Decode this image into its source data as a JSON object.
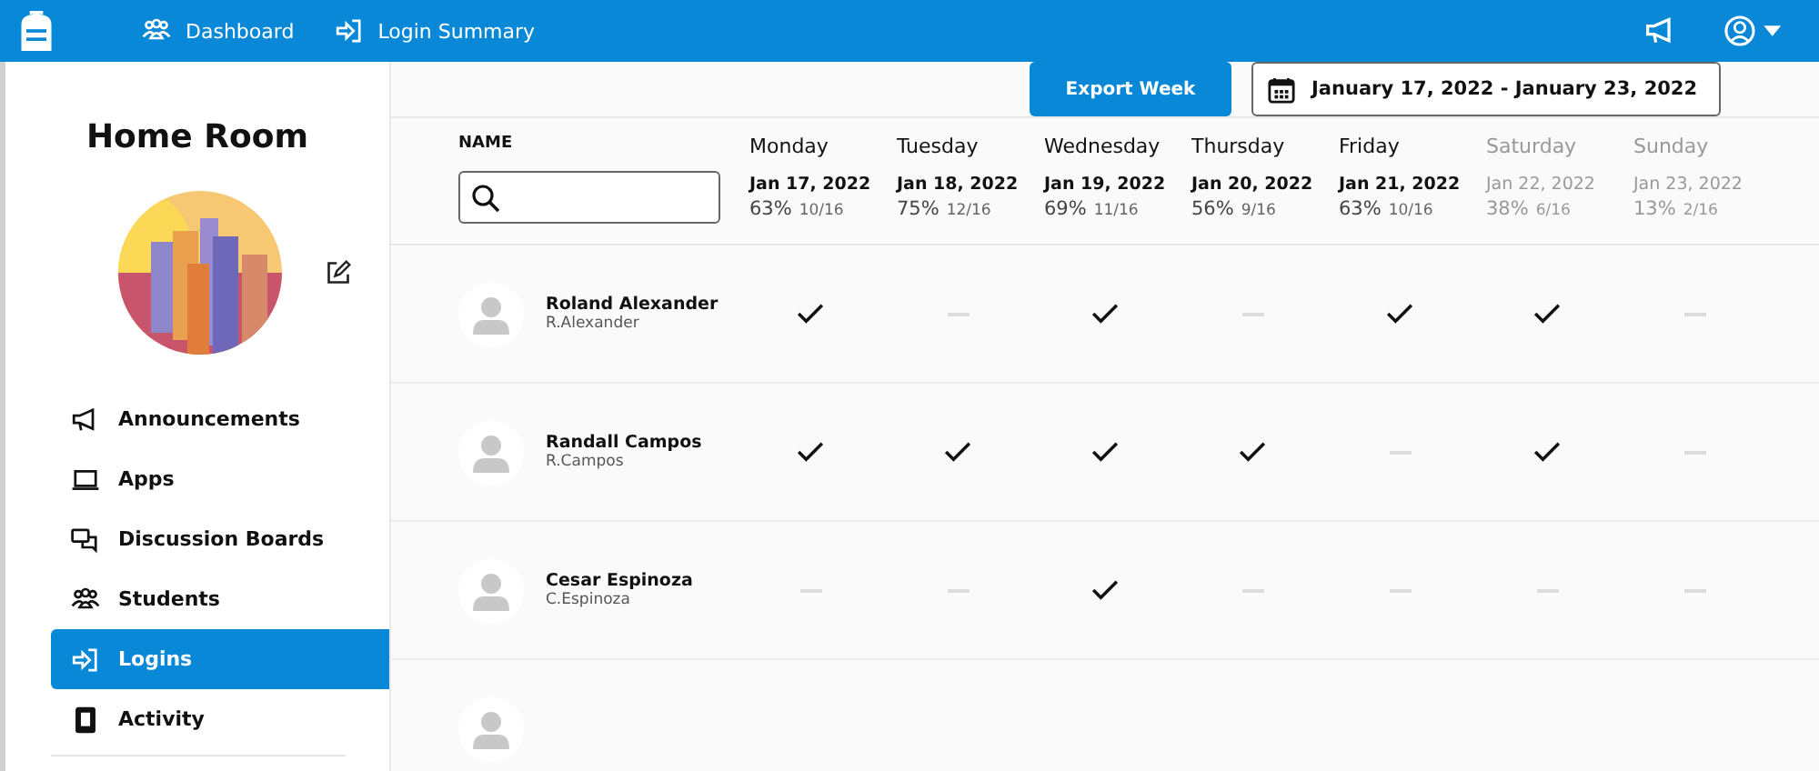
{
  "topbar": {
    "links": [
      {
        "label": "Dashboard",
        "kind": "people"
      },
      {
        "label": "Login Summary",
        "kind": "login"
      }
    ]
  },
  "sidebar": {
    "title": "Home Room",
    "items": [
      {
        "label": "Announcements",
        "kind": "megaphone",
        "selected": false
      },
      {
        "label": "Apps",
        "kind": "laptop",
        "selected": false
      },
      {
        "label": "Discussion Boards",
        "kind": "chat",
        "selected": false
      },
      {
        "label": "Students",
        "kind": "people",
        "selected": false
      },
      {
        "label": "Logins",
        "kind": "login",
        "selected": true
      },
      {
        "label": "Activity",
        "kind": "tablet",
        "selected": false
      }
    ]
  },
  "toolbar": {
    "export_button": "Export Week",
    "date_range": "January 17, 2022 - January 23, 2022"
  },
  "table": {
    "name_heading": "NAME",
    "days": [
      {
        "day": "Monday",
        "date": "Jan 17, 2022",
        "percent": "63%",
        "count": "10/16",
        "dimmed": false
      },
      {
        "day": "Tuesday",
        "date": "Jan 18, 2022",
        "percent": "75%",
        "count": "12/16",
        "dimmed": false
      },
      {
        "day": "Wednesday",
        "date": "Jan 19, 2022",
        "percent": "69%",
        "count": "11/16",
        "dimmed": false
      },
      {
        "day": "Thursday",
        "date": "Jan 20, 2022",
        "percent": "56%",
        "count": "9/16",
        "dimmed": false
      },
      {
        "day": "Friday",
        "date": "Jan 21, 2022",
        "percent": "63%",
        "count": "10/16",
        "dimmed": false
      },
      {
        "day": "Saturday",
        "date": "Jan 22, 2022",
        "percent": "38%",
        "count": "6/16",
        "dimmed": true
      },
      {
        "day": "Sunday",
        "date": "Jan 23, 2022",
        "percent": "13%",
        "count": "2/16",
        "dimmed": true
      }
    ],
    "rows": [
      {
        "name": "Roland Alexander",
        "username": "R.Alexander",
        "logins": [
          true,
          false,
          true,
          false,
          true,
          true,
          false
        ]
      },
      {
        "name": "Randall Campos",
        "username": "R.Campos",
        "logins": [
          true,
          true,
          true,
          true,
          false,
          true,
          false
        ]
      },
      {
        "name": "Cesar Espinoza",
        "username": "C.Espinoza",
        "logins": [
          false,
          false,
          true,
          false,
          false,
          false,
          false
        ]
      }
    ]
  }
}
